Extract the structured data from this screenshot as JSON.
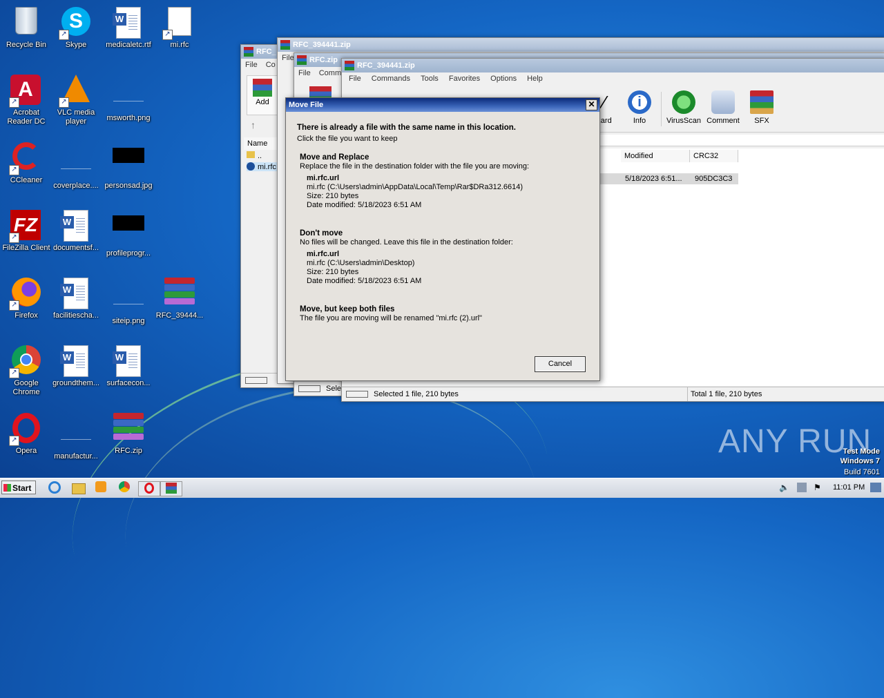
{
  "desktop": {
    "icons": [
      {
        "label": "Recycle Bin"
      },
      {
        "label": "Skype"
      },
      {
        "label": "medicaletc.rtf"
      },
      {
        "label": "mi.rfc"
      },
      {
        "label": "Acrobat Reader DC"
      },
      {
        "label": "VLC media player"
      },
      {
        "label": "msworth.png"
      },
      {
        "label": "CCleaner"
      },
      {
        "label": "coverplace...."
      },
      {
        "label": "personsad.jpg"
      },
      {
        "label": "FileZilla Client"
      },
      {
        "label": "documentsf..."
      },
      {
        "label": "profileprogr..."
      },
      {
        "label": "Firefox"
      },
      {
        "label": "facilitiescha..."
      },
      {
        "label": "siteip.png"
      },
      {
        "label": "RFC_39444..."
      },
      {
        "label": "Google Chrome"
      },
      {
        "label": "groundthem..."
      },
      {
        "label": "surfacecon..."
      },
      {
        "label": "Opera"
      },
      {
        "label": "manufactur..."
      },
      {
        "label": "RFC.zip"
      }
    ]
  },
  "windows": {
    "back1": {
      "title": "RFC_",
      "menu": [
        "File",
        "Co"
      ],
      "add": "Add",
      "col_name": "Name",
      "rows": [
        "..",
        "mi.rfc"
      ]
    },
    "back2": {
      "title": "RFC_394441.zip",
      "menu": [
        "File"
      ]
    },
    "back3": {
      "title": "RFC.zip",
      "menu": [
        "File",
        "Comm"
      ],
      "status": "Sele"
    },
    "main": {
      "title": "RFC_394441.zip",
      "menu": [
        "File",
        "Commands",
        "Tools",
        "Favorites",
        "Options",
        "Help"
      ],
      "toolbar": [
        "zard",
        "Info",
        "VirusScan",
        "Comment",
        "SFX"
      ],
      "columns": [
        "Modified",
        "CRC32"
      ],
      "row": {
        "modified": "5/18/2023 6:51...",
        "crc": "905DC3C3"
      },
      "status_left": "Selected 1 file, 210 bytes",
      "status_right": "Total 1 file, 210 bytes"
    }
  },
  "dialog": {
    "title": "Move File",
    "close": "✕",
    "heading": "There is already a file with the same name in this location.",
    "subheading": "Click the file you want to keep",
    "replace": {
      "title": "Move and Replace",
      "desc": "Replace the file in the destination folder with the file you are moving:",
      "file": "mi.rfc.url",
      "path": "mi.rfc (C:\\Users\\admin\\AppData\\Local\\Temp\\Rar$DRa312.6614)",
      "size": "Size: 210 bytes",
      "date": "Date modified: 5/18/2023 6:51 AM"
    },
    "dontmove": {
      "title": "Don't move",
      "desc": "No files will be changed. Leave this file in the destination folder:",
      "file": "mi.rfc.url",
      "path": "mi.rfc (C:\\Users\\admin\\Desktop)",
      "size": "Size: 210 bytes",
      "date": "Date modified: 5/18/2023 6:51 AM"
    },
    "keepboth": {
      "title": "Move, but keep both files",
      "desc": "The file you are moving will be renamed \"mi.rfc (2).url\""
    },
    "cancel": "Cancel"
  },
  "taskbar": {
    "start": "Start",
    "clock": "11:01 PM"
  },
  "watermark": {
    "text": "ANY RUN",
    "mode1": "Test Mode",
    "mode2": "Windows 7",
    "mode3": "Build 7601"
  }
}
